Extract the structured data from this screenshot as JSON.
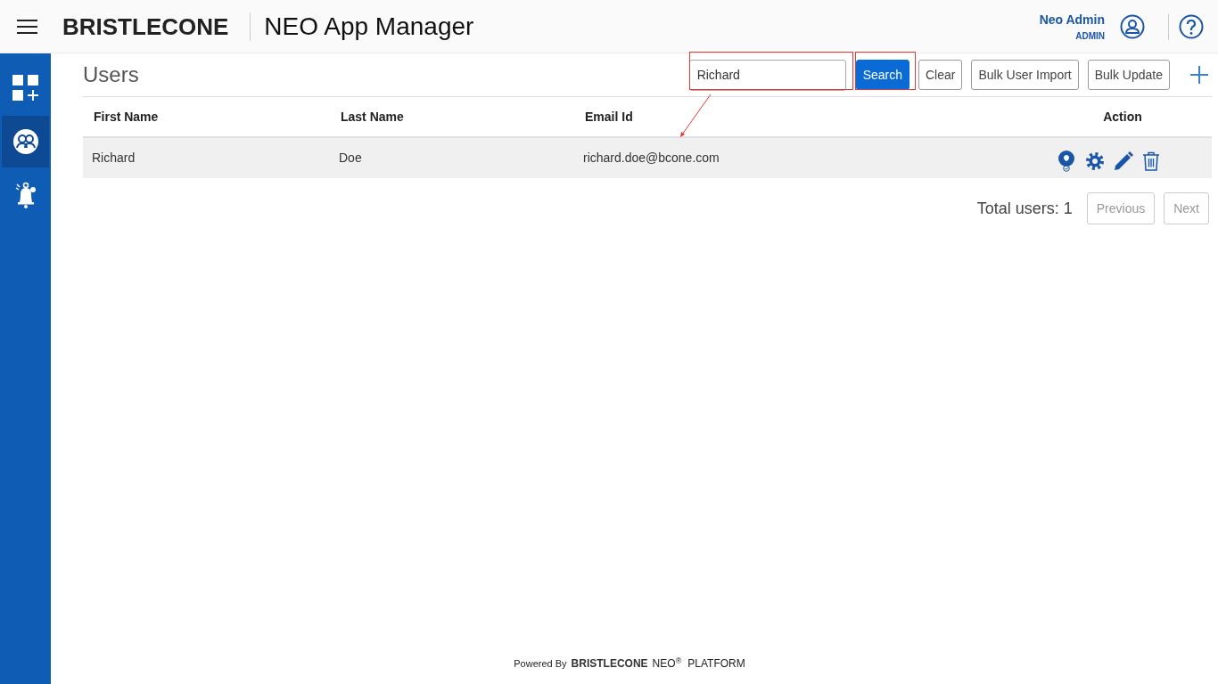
{
  "header": {
    "logo": "BRISTLECONE",
    "app_title": "NEO App Manager",
    "user_name": "Neo Admin",
    "user_role": "ADMIN"
  },
  "sidebar": {
    "items": [
      {
        "kind": "apps",
        "selected": false
      },
      {
        "kind": "users",
        "selected": true
      },
      {
        "kind": "alerts",
        "selected": false
      }
    ]
  },
  "page": {
    "title": "Users",
    "search": {
      "value": "Richard"
    },
    "buttons": [
      {
        "label": "Search",
        "kind": "primary"
      },
      {
        "label": "Clear",
        "kind": "outline"
      },
      {
        "label": "Bulk User Import",
        "kind": "outline"
      },
      {
        "label": "Bulk Update",
        "kind": "outline"
      }
    ]
  },
  "table": {
    "columns": [
      "First Name",
      "Last Name",
      "Email Id",
      "Action"
    ],
    "rows": [
      {
        "first_name": "Richard",
        "last_name": "Doe",
        "email": "richard.doe@bcone.com"
      }
    ]
  },
  "pagination": {
    "total": "Total users: 1",
    "previous": "Previous",
    "next": "Next"
  },
  "footer": {
    "powered_by": "Powered By",
    "logo": "BRISTLECONE",
    "neo": "NEO$^{®}$",
    "platform": "PLATFORM"
  }
}
